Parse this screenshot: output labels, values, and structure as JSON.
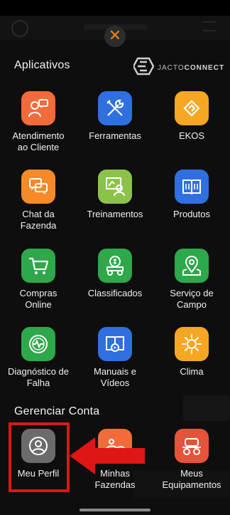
{
  "close_icon": "close-icon",
  "sections": {
    "apps_title": "Aplicativos",
    "account_title": "Gerenciar Conta"
  },
  "brand": {
    "name_light": "JACTO",
    "name_bold": "CONNECT"
  },
  "apps": [
    {
      "label": "Atendimento\nao Cliente",
      "icon": "chat-person-icon",
      "color": "#f26b3a"
    },
    {
      "label": "Ferramentas",
      "icon": "tools-icon",
      "color": "#2f6fe0"
    },
    {
      "label": "EKOS",
      "icon": "ekos-logo-icon",
      "color": "#f5a623"
    },
    {
      "label": "Chat da\nFazenda",
      "icon": "chat-bubbles-icon",
      "color": "#f58a2a"
    },
    {
      "label": "Treinamentos",
      "icon": "training-board-icon",
      "color": "#8bc34a"
    },
    {
      "label": "Produtos",
      "icon": "catalog-book-icon",
      "color": "#2f6fe0"
    },
    {
      "label": "Compras\nOnline",
      "icon": "shopping-cart-icon",
      "color": "#2ea84a"
    },
    {
      "label": "Classificados",
      "icon": "money-tractor-icon",
      "color": "#2ea84a"
    },
    {
      "label": "Serviço de\nCampo",
      "icon": "map-pin-icon",
      "color": "#2ea84a"
    },
    {
      "label": "Diagnóstico de\nFalha",
      "icon": "diagnostic-pulse-icon",
      "color": "#2ea84a"
    },
    {
      "label": "Manuais e\nVídeos",
      "icon": "manual-video-icon",
      "color": "#2f6fe0"
    },
    {
      "label": "Clima",
      "icon": "sun-icon",
      "color": "#f5a623"
    }
  ],
  "account": [
    {
      "label": "Meu Perfil",
      "icon": "user-profile-icon",
      "color": "#6b6b6b"
    },
    {
      "label": "Minhas\nFazendas",
      "icon": "farm-landscape-icon",
      "color": "#f26b3a"
    },
    {
      "label": "Meus\nEquipamentos",
      "icon": "sprayer-equipment-icon",
      "color": "#e5533a"
    }
  ],
  "highlight_color": "#e01515"
}
